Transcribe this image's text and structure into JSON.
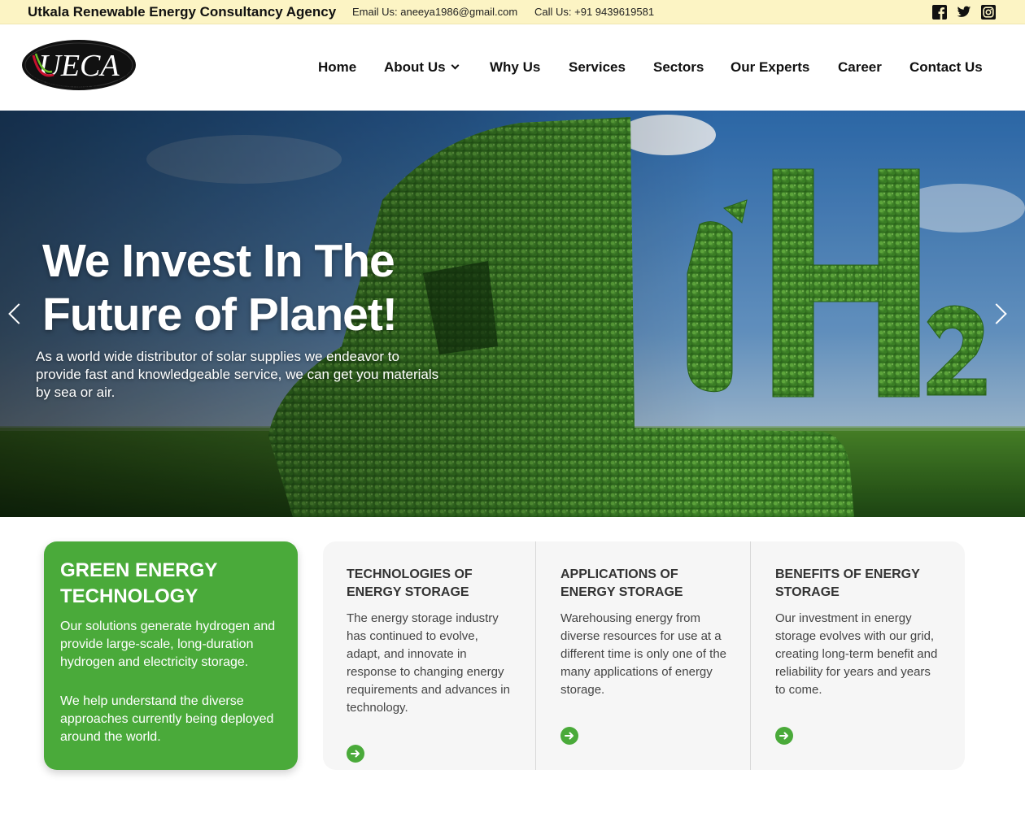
{
  "topbar": {
    "brand": "Utkala Renewable Energy Consultancy Agency",
    "email_text": "Email Us: aneeya1986@gmail.com",
    "phone_text": "Call Us: +91 9439619581",
    "social_icons": [
      "facebook-icon",
      "twitter-icon",
      "instagram-icon"
    ]
  },
  "logo": {
    "text": "UECA",
    "tagline": "Utkala Renewable Energy Consultancy Agency"
  },
  "nav": {
    "items": [
      {
        "label": "Home"
      },
      {
        "label": "About Us",
        "has_dropdown": true
      },
      {
        "label": "Why Us"
      },
      {
        "label": "Services"
      },
      {
        "label": "Sectors"
      },
      {
        "label": "Our Experts"
      },
      {
        "label": "Career"
      },
      {
        "label": "Contact Us"
      }
    ]
  },
  "hero": {
    "title_line1": "We Invest In The",
    "title_line2": "Future of Planet!",
    "subtitle": "As a world wide distributor of solar supplies we endeavor to provide fast and knowledgeable service, we can get you materials by sea or air.",
    "image_text": "H2"
  },
  "feature": {
    "title_line1": "GREEN ENERGY",
    "title_line2": "TECHNOLOGY",
    "para1": "Our solutions generate hydrogen and provide large-scale, long-duration hydrogen and electricity storage.",
    "para2": "We help understand the diverse approaches currently being deployed around the world."
  },
  "cards": [
    {
      "title": "TECHNOLOGIES OF ENERGY STORAGE",
      "text": "The energy storage industry has continued to evolve, adapt, and innovate in response to changing energy requirements and advances in technology."
    },
    {
      "title": "APPLICATIONS OF ENERGY STORAGE",
      "text": "Warehousing energy from diverse resources for use at a different time is only one of the many applications of energy storage."
    },
    {
      "title": "BENEFITS OF ENERGY STORAGE",
      "text": "Our investment in energy storage evolves with our grid, creating long-term benefit and reliability for years and years to come."
    }
  ],
  "colors": {
    "accent_green": "#4aaa3a",
    "topbar_bg": "#fcf4c4",
    "cards_bg": "#f6f6f6"
  }
}
